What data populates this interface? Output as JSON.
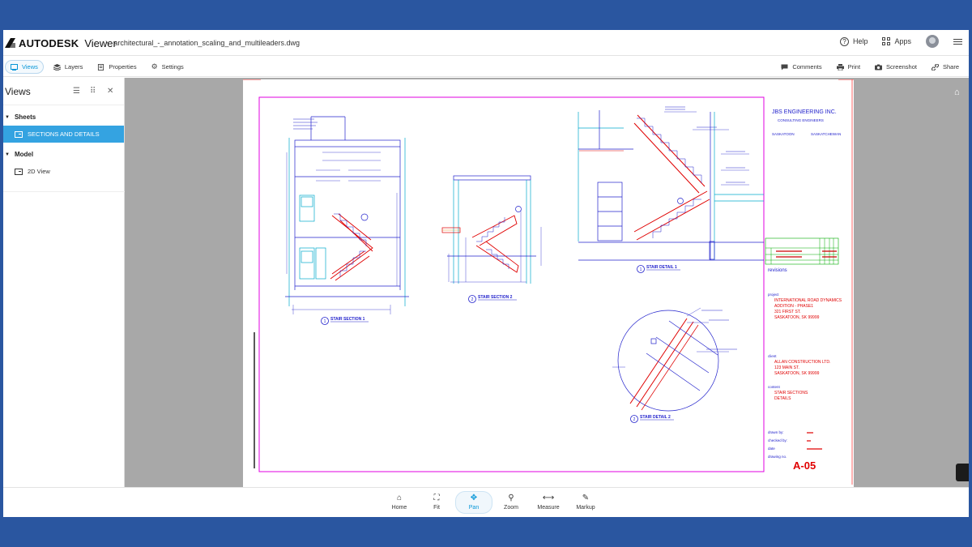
{
  "header": {
    "brand": "AUTODESK",
    "product": "Viewer",
    "file_name": "architectural_-_annotation_scaling_and_multileaders.dwg",
    "help_label": "Help",
    "apps_label": "Apps"
  },
  "toolbar": {
    "tabs": [
      {
        "label": "Views",
        "icon": "views-icon"
      },
      {
        "label": "Layers",
        "icon": "layers-icon"
      },
      {
        "label": "Properties",
        "icon": "properties-icon"
      },
      {
        "label": "Settings",
        "icon": "gear-icon"
      }
    ],
    "actions": [
      {
        "label": "Comments",
        "icon": "comment-icon"
      },
      {
        "label": "Print",
        "icon": "print-icon"
      },
      {
        "label": "Screenshot",
        "icon": "camera-icon"
      },
      {
        "label": "Share",
        "icon": "link-icon"
      }
    ]
  },
  "sidebar": {
    "title": "Views",
    "sheets_label": "Sheets",
    "sheet_item": "SECTIONS AND DETAILS",
    "model_label": "Model",
    "model_item": "2D View"
  },
  "drawing": {
    "firm": "JBS ENGINEERING INC.",
    "firm_sub": "CONSULTING ENGINEERS",
    "city1": "SASKATOON",
    "city2": "SASKATCHEWAN",
    "revisions": "revisions",
    "project_label": "project",
    "project_lines": [
      "INTERNATIONAL ROAD DYNAMICS",
      "ADDITION - PHASE1",
      "321 FIRST ST.",
      "SASKATOON, SK 99999"
    ],
    "client_label": "client",
    "client_lines": [
      "ALLAN CONSTRUCTION LTD.",
      "123 MAIN ST.",
      "SASKATOON, SK 99999"
    ],
    "content_label": "content",
    "content_lines": [
      "STAIR SECTIONS",
      "DETAILS"
    ],
    "drawn_by": "drawn by:",
    "checked_by": "checked by:",
    "date": "date",
    "drawing_no": "drawing no.",
    "sheet_number": "A-05",
    "views": [
      {
        "num": "1",
        "title": "STAIR SECTION 1"
      },
      {
        "num": "2",
        "title": "STAIR SECTION 2"
      },
      {
        "num": "1",
        "title": "STAIR DETAIL 1"
      },
      {
        "num": "2",
        "title": "STAIR DETAIL 2"
      }
    ]
  },
  "bottom_tools": [
    {
      "label": "Home",
      "icon": "home-icon"
    },
    {
      "label": "Fit",
      "icon": "fit-icon"
    },
    {
      "label": "Pan",
      "icon": "pan-icon",
      "active": true
    },
    {
      "label": "Zoom",
      "icon": "zoom-icon"
    },
    {
      "label": "Measure",
      "icon": "measure-icon"
    },
    {
      "label": "Markup",
      "icon": "markup-icon"
    }
  ]
}
